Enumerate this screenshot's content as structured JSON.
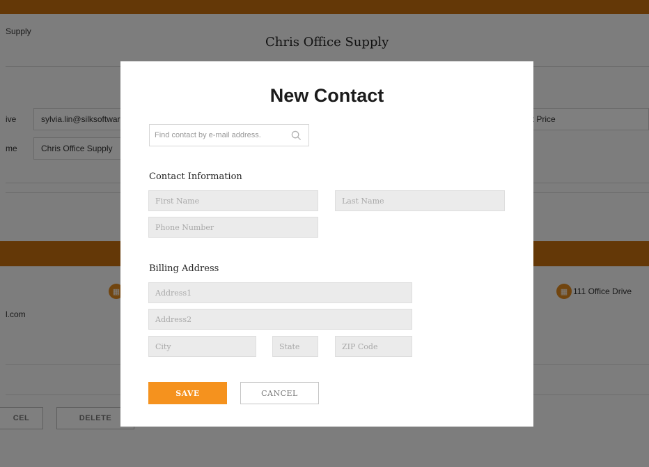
{
  "background": {
    "company_small": "Supply",
    "company_title": "Chris Office Supply",
    "row1_label": "ive",
    "row1_value": "sylvia.lin@silksoftware",
    "row1_right": "ot Price",
    "row2_label": "me",
    "row2_value": "Chris Office Supply",
    "email_fragment": "l.com",
    "address_text": "111 Office Drive",
    "cancel_label": "CEL",
    "delete_label": "DELETE"
  },
  "modal": {
    "title": "New Contact",
    "search": {
      "placeholder": "Find contact by e-mail address.",
      "value": ""
    },
    "contact_section": "Contact Information",
    "first_name": {
      "placeholder": "First Name",
      "value": ""
    },
    "last_name": {
      "placeholder": "Last Name",
      "value": ""
    },
    "phone": {
      "placeholder": "Phone Number",
      "value": ""
    },
    "billing_section": "Billing Address",
    "address1": {
      "placeholder": "Address1",
      "value": ""
    },
    "address2": {
      "placeholder": "Address2",
      "value": ""
    },
    "city": {
      "placeholder": "City",
      "value": ""
    },
    "state": {
      "placeholder": "State",
      "value": ""
    },
    "zip": {
      "placeholder": "ZIP Code",
      "value": ""
    },
    "save_label": "SAVE",
    "cancel_label": "CANCEL"
  },
  "icons": {
    "search": "search-icon",
    "building": "building-icon"
  },
  "colors": {
    "accent": "#f5921e",
    "brand_bar": "#c8710f",
    "overlay": "rgba(0,0,0,0.5)"
  }
}
